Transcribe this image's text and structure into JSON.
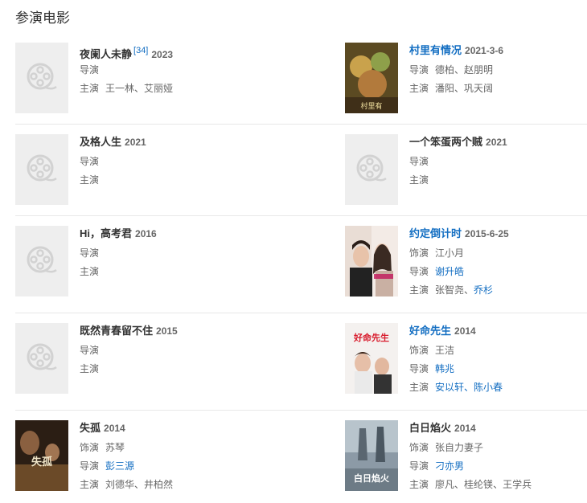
{
  "section": {
    "title": "参演电影"
  },
  "labels": {
    "director": "导演",
    "cast": "主演",
    "role": "饰演",
    "sep": "、"
  },
  "movies": [
    {
      "title": "夜阑人未静",
      "ref": "[34]",
      "year": "2023",
      "cast": [
        "王一林",
        "艾丽娅"
      ]
    },
    {
      "title": "村里有情况",
      "year": "2021-3-6",
      "director": [
        "德柏",
        "赵朋明"
      ],
      "cast": [
        "潘阳",
        "巩天阔"
      ],
      "poster_text": "村里有"
    },
    {
      "title": "及格人生",
      "year": "2021"
    },
    {
      "title": "一个笨蛋两个贼",
      "year": "2021"
    },
    {
      "title": "Hi，高考君",
      "year": "2016"
    },
    {
      "title": "约定倒计时",
      "year": "2015-6-25",
      "role": "江小月",
      "director": "谢升皓",
      "cast": [
        "张智尧",
        "乔杉"
      ]
    },
    {
      "title": "既然青春留不住",
      "year": "2015"
    },
    {
      "title": "好命先生",
      "year": "2014",
      "role": "王洁",
      "director": "韩兆",
      "cast": [
        "安以轩",
        "陈小春"
      ],
      "poster_text": "好命先生"
    },
    {
      "title": "失孤",
      "year": "2014",
      "role": "苏琴",
      "director": "彭三源",
      "cast": [
        "刘德华",
        "井柏然"
      ],
      "poster_text": "失孤"
    },
    {
      "title": "白日焰火",
      "year": "2014",
      "role": "张自力妻子",
      "director": "刁亦男",
      "cast": [
        "廖凡",
        "桂纶镁",
        "王学兵"
      ],
      "poster_text": "白日焰火"
    }
  ],
  "colors": {
    "link": "#136ec2",
    "text": "#333333",
    "meta": "#666666",
    "placeholder_bg": "#eeeeee"
  }
}
